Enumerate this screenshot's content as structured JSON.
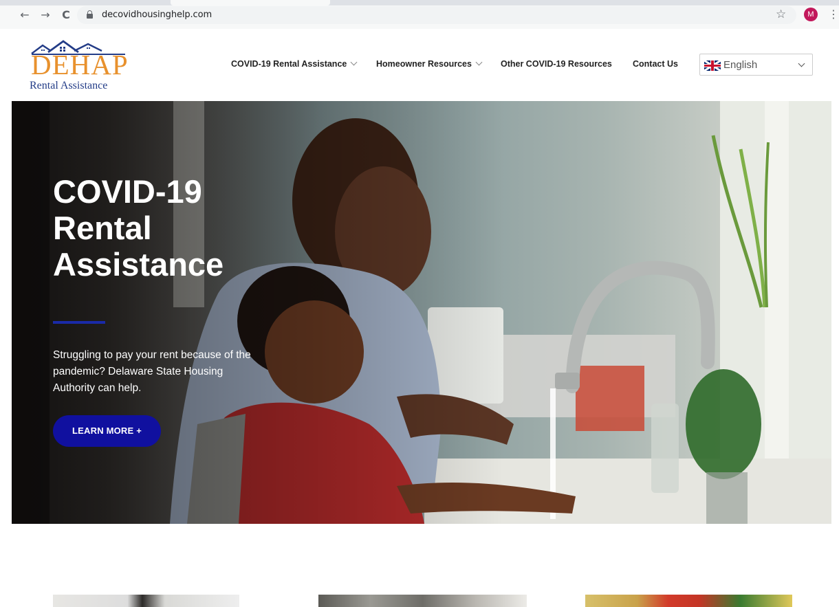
{
  "browser": {
    "url": "decovidhousinghelp.com",
    "profile_initial": "M",
    "back_icon": "←",
    "forward_icon": "→",
    "reload_icon": "C",
    "star_icon": "☆",
    "menu_icon": "⋮"
  },
  "logo": {
    "word": "DEHAP",
    "subtitle": "Rental Assistance"
  },
  "nav": {
    "items": [
      {
        "label": "COVID-19 Rental Assistance",
        "has_dropdown": true
      },
      {
        "label": "Homeowner Resources",
        "has_dropdown": true
      },
      {
        "label": "Other COVID-19 Resources",
        "has_dropdown": false
      },
      {
        "label": "Contact Us",
        "has_dropdown": false
      }
    ]
  },
  "language": {
    "selected": "English",
    "flag_icon": "uk-flag-icon"
  },
  "hero": {
    "title": "COVID-19 Rental Assistance",
    "text": "Struggling to pay your rent because of the pandemic? Delaware State Housing Authority can help.",
    "button_label": "LEARN MORE  +"
  },
  "colors": {
    "brand_blue": "#10109f",
    "accent_rule": "#1a2aa8",
    "logo_orange": "#e8912d",
    "logo_navy": "#233c87"
  }
}
